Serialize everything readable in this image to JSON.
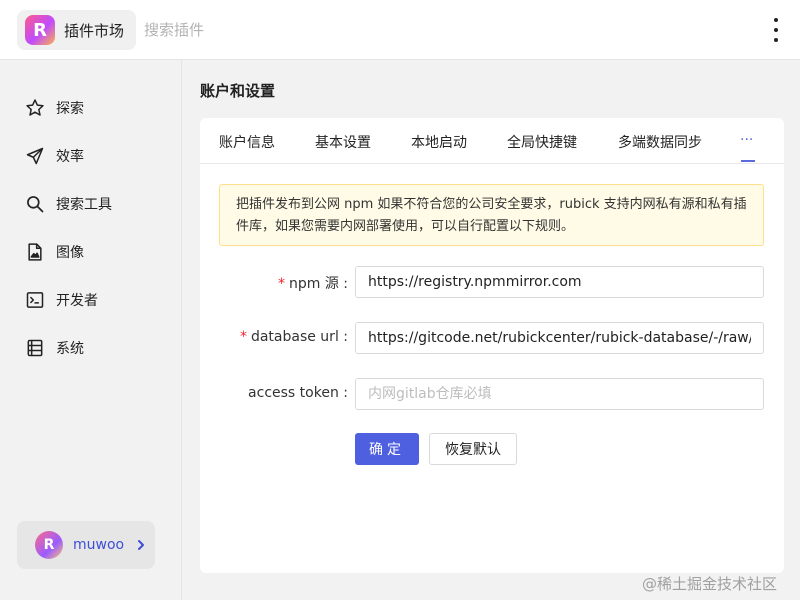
{
  "header": {
    "logo_letter": "R",
    "app_title": "插件市场",
    "search_placeholder": "搜索插件"
  },
  "sidebar": {
    "items": [
      {
        "label": "探索",
        "icon": "star-icon"
      },
      {
        "label": "效率",
        "icon": "send-icon"
      },
      {
        "label": "搜索工具",
        "icon": "search-icon"
      },
      {
        "label": "图像",
        "icon": "image-file-icon"
      },
      {
        "label": "开发者",
        "icon": "terminal-icon"
      },
      {
        "label": "系统",
        "icon": "system-icon"
      }
    ],
    "user": {
      "avatar_letter": "R",
      "name": "muwoo"
    }
  },
  "main": {
    "page_title": "账户和设置",
    "tabs": [
      "账户信息",
      "基本设置",
      "本地启动",
      "全局快捷键",
      "多端数据同步",
      "···"
    ],
    "active_tab": "···",
    "notice_text": "把插件发布到公网 npm 如果不符合您的公司安全要求，rubick 支持内网私有源和私有插件库，如果您需要内网部署使用，可以自行配置以下规则。",
    "form": {
      "npm_label": "npm 源 :",
      "npm_value": "https://registry.npmmirror.com",
      "db_label": "database url :",
      "db_value": "https://gitcode.net/rubickcenter/rubick-database/-/raw/master",
      "token_label": "access token :",
      "token_placeholder": "内网gitlab仓库必填",
      "required_mark": "*"
    },
    "buttons": {
      "confirm": "确定",
      "reset": "恢复默认"
    }
  },
  "watermark": "@稀土掘金技术社区",
  "colors": {
    "accent": "#4e5fe0",
    "notice_bg": "#fffbe6",
    "notice_border": "#ffe08a",
    "required": "#f5222d"
  }
}
